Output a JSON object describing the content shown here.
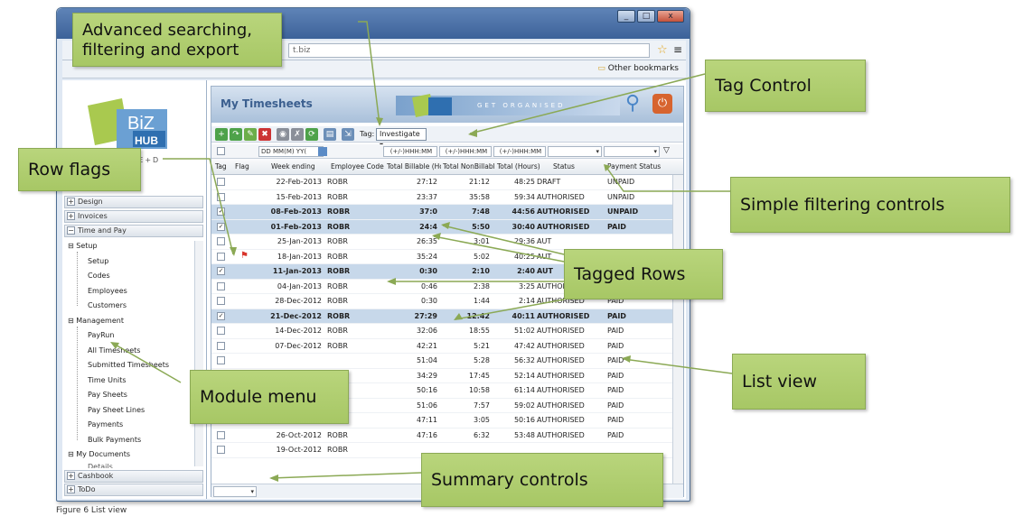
{
  "browser": {
    "url": "t.biz",
    "bookmarks": "Other bookmarks",
    "win_buttons": [
      "_",
      "□",
      "x"
    ]
  },
  "sidebar": {
    "tagline": "N+S+E+D",
    "sections": [
      {
        "label": "Design",
        "sign": "+"
      },
      {
        "label": "Invoices",
        "sign": "+"
      },
      {
        "label": "Time and Pay",
        "sign": "−"
      }
    ],
    "setup": {
      "label": "Setup",
      "items": [
        "Setup",
        "Codes",
        "Employees",
        "Customers"
      ]
    },
    "management": {
      "label": "Management",
      "items": [
        "PayRun",
        "All Timesheets",
        "Submitted Timesheets",
        "Time Units",
        "Pay Sheets",
        "Pay Sheet Lines",
        "Payments",
        "Bulk Payments"
      ]
    },
    "mydocs": {
      "label": "My Documents",
      "items": [
        "Details"
      ]
    },
    "bottom": [
      {
        "label": "Cashbook",
        "sign": "+"
      },
      {
        "label": "ToDo",
        "sign": "+"
      }
    ]
  },
  "app": {
    "title": "My Timesheets",
    "banner_text": "GET ORGANISED",
    "tag_label": "Tag:",
    "tag_value": "Investigate"
  },
  "filters": {
    "date": "DD MM(M) YY(",
    "bill": "(+/-)HHH:MM",
    "nonbill": "(+/-)HHH:MM",
    "total": "(+/-)HHH:MM"
  },
  "columns": [
    "Tag",
    "Flag",
    "Week ending",
    "Employee Code",
    "Total Billable (Ho",
    "Total NonBillable",
    "Total (Hours)",
    "Status",
    "Payment Status"
  ],
  "rows": [
    {
      "date": "22-Feb-2013",
      "emp": "ROBR",
      "bill": "27:12",
      "non": "21:12",
      "total": "48:25",
      "status": "DRAFT",
      "pay": "UNPAID",
      "tag": false,
      "flag": false
    },
    {
      "date": "15-Feb-2013",
      "emp": "ROBR",
      "bill": "23:37",
      "non": "35:58",
      "total": "59:34",
      "status": "AUTHORISED",
      "pay": "UNPAID",
      "tag": false,
      "flag": false
    },
    {
      "date": "08-Feb-2013",
      "emp": "ROBR",
      "bill": "37:0",
      "non": "7:48",
      "total": "44:56",
      "status": "AUTHORISED",
      "pay": "UNPAID",
      "tag": true,
      "flag": false
    },
    {
      "date": "01-Feb-2013",
      "emp": "ROBR",
      "bill": "24:4",
      "non": "5:50",
      "total": "30:40",
      "status": "AUTHORISED",
      "pay": "PAID",
      "tag": true,
      "flag": false
    },
    {
      "date": "25-Jan-2013",
      "emp": "ROBR",
      "bill": "26:35",
      "non": "3:01",
      "total": "29:36",
      "status": "AUT",
      "pay": "",
      "tag": false,
      "flag": false
    },
    {
      "date": "18-Jan-2013",
      "emp": "ROBR",
      "bill": "35:24",
      "non": "5:02",
      "total": "40:25",
      "status": "AUT",
      "pay": "",
      "tag": false,
      "flag": true
    },
    {
      "date": "11-Jan-2013",
      "emp": "ROBR",
      "bill": "0:30",
      "non": "2:10",
      "total": "2:40",
      "status": "AUT",
      "pay": "",
      "tag": true,
      "flag": false
    },
    {
      "date": "04-Jan-2013",
      "emp": "ROBR",
      "bill": "0:46",
      "non": "2:38",
      "total": "3:25",
      "status": "AUTHORISED",
      "pay": "PAID",
      "tag": false,
      "flag": false
    },
    {
      "date": "28-Dec-2012",
      "emp": "ROBR",
      "bill": "0:30",
      "non": "1:44",
      "total": "2:14",
      "status": "AUTHORISED",
      "pay": "PAID",
      "tag": false,
      "flag": false
    },
    {
      "date": "21-Dec-2012",
      "emp": "ROBR",
      "bill": "27:29",
      "non": "12:42",
      "total": "40:11",
      "status": "AUTHORISED",
      "pay": "PAID",
      "tag": true,
      "flag": false
    },
    {
      "date": "14-Dec-2012",
      "emp": "ROBR",
      "bill": "32:06",
      "non": "18:55",
      "total": "51:02",
      "status": "AUTHORISED",
      "pay": "PAID",
      "tag": false,
      "flag": false
    },
    {
      "date": "07-Dec-2012",
      "emp": "ROBR",
      "bill": "42:21",
      "non": "5:21",
      "total": "47:42",
      "status": "AUTHORISED",
      "pay": "PAID",
      "tag": false,
      "flag": false
    },
    {
      "date": "",
      "emp": "",
      "bill": "51:04",
      "non": "5:28",
      "total": "56:32",
      "status": "AUTHORISED",
      "pay": "PAID",
      "tag": false,
      "flag": false
    },
    {
      "date": "",
      "emp": "",
      "bill": "34:29",
      "non": "17:45",
      "total": "52:14",
      "status": "AUTHORISED",
      "pay": "PAID",
      "tag": false,
      "flag": false
    },
    {
      "date": "",
      "emp": "",
      "bill": "50:16",
      "non": "10:58",
      "total": "61:14",
      "status": "AUTHORISED",
      "pay": "PAID",
      "tag": false,
      "flag": false
    },
    {
      "date": "",
      "emp": "",
      "bill": "51:06",
      "non": "7:57",
      "total": "59:02",
      "status": "AUTHORISED",
      "pay": "PAID",
      "tag": false,
      "flag": false
    },
    {
      "date": "02-Nov-2012",
      "emp": "ROBR",
      "bill": "47:11",
      "non": "3:05",
      "total": "50:16",
      "status": "AUTHORISED",
      "pay": "PAID",
      "tag": false,
      "flag": false
    },
    {
      "date": "26-Oct-2012",
      "emp": "ROBR",
      "bill": "47:16",
      "non": "6:32",
      "total": "53:48",
      "status": "AUTHORISED",
      "pay": "PAID",
      "tag": false,
      "flag": false
    },
    {
      "date": "19-Oct-2012",
      "emp": "ROBR",
      "bill": "",
      "non": "",
      "total": "",
      "status": "",
      "pay": "",
      "tag": false,
      "flag": false
    }
  ],
  "callouts": {
    "search": "Advanced searching, filtering and export",
    "tag": "Tag Control",
    "flags": "Row flags",
    "filter": "Simple filtering controls",
    "tagged": "Tagged Rows",
    "list": "List view",
    "menu": "Module menu",
    "summary": "Summary controls"
  },
  "caption": "Figure 6 List view",
  "colors": {
    "callout": "#b9d57c",
    "tagged_row": "#c7d8ea",
    "title_blue": "#3b5f8f"
  }
}
